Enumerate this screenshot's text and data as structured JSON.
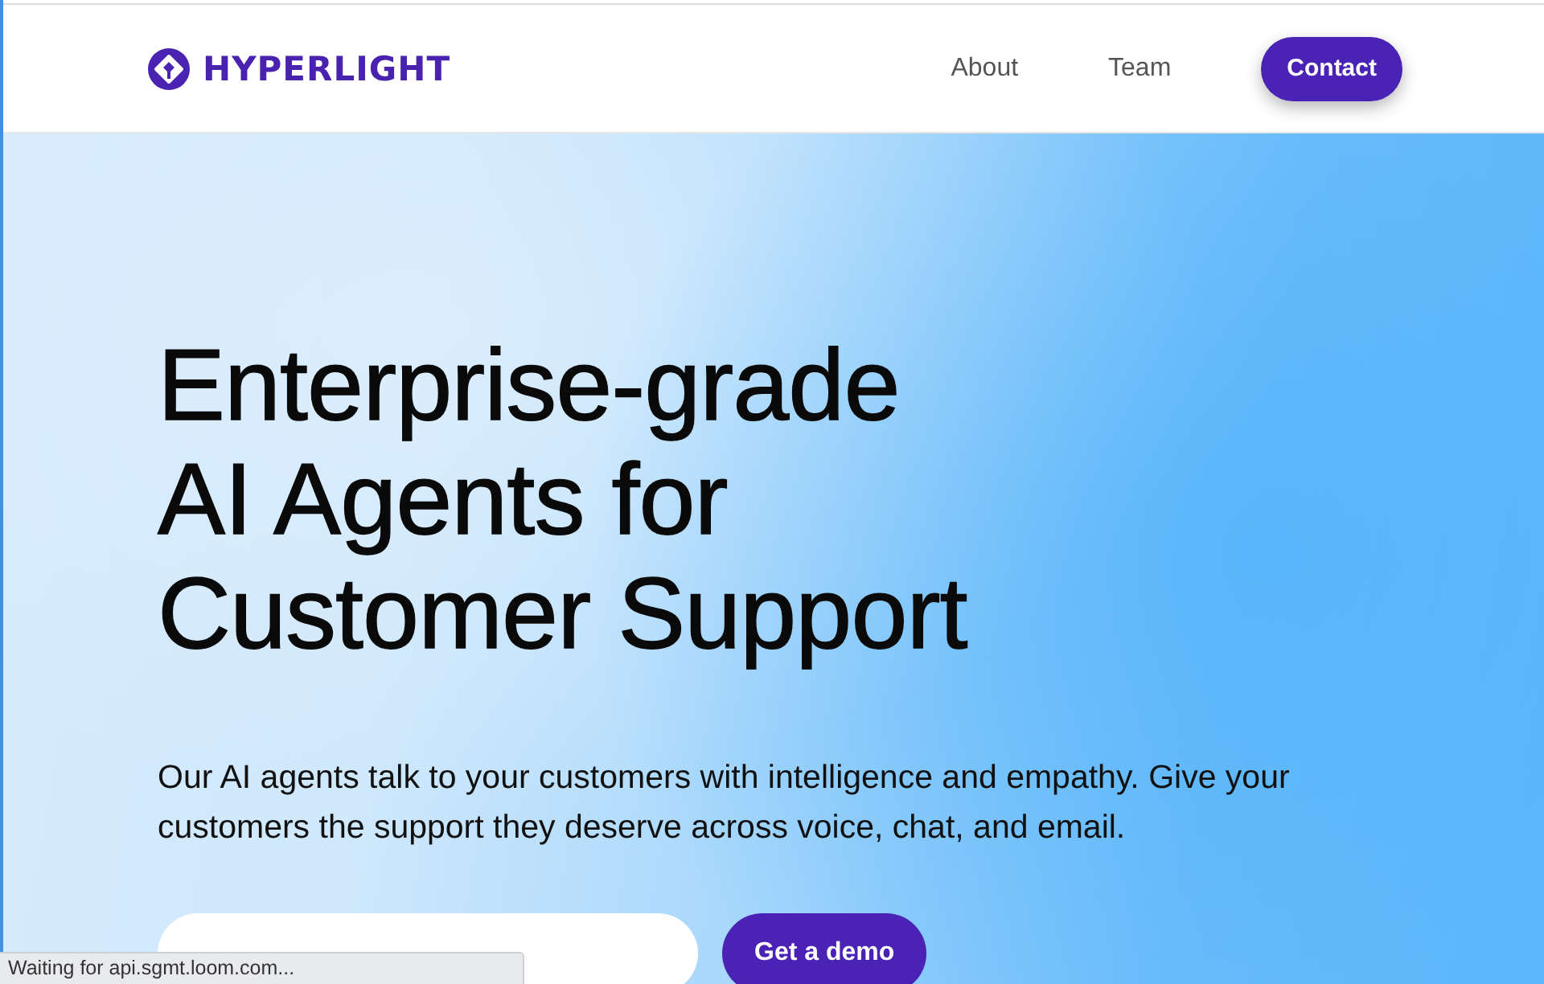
{
  "header": {
    "logo": {
      "text": "HYPERLIGHT"
    },
    "nav": [
      {
        "label": "About"
      },
      {
        "label": "Team"
      }
    ],
    "cta": {
      "label": "Contact"
    }
  },
  "hero": {
    "headline_lines": [
      "Enterprise-grade",
      "AI Agents for",
      "Customer Support"
    ],
    "subtitle": "Our AI agents talk to your customers with intelligence and empathy. Give your customers the support they deserve across voice, chat, and email.",
    "form": {
      "button": "Get a demo"
    }
  },
  "status_bar": {
    "text": "Waiting for api.sgmt.loom.com..."
  }
}
